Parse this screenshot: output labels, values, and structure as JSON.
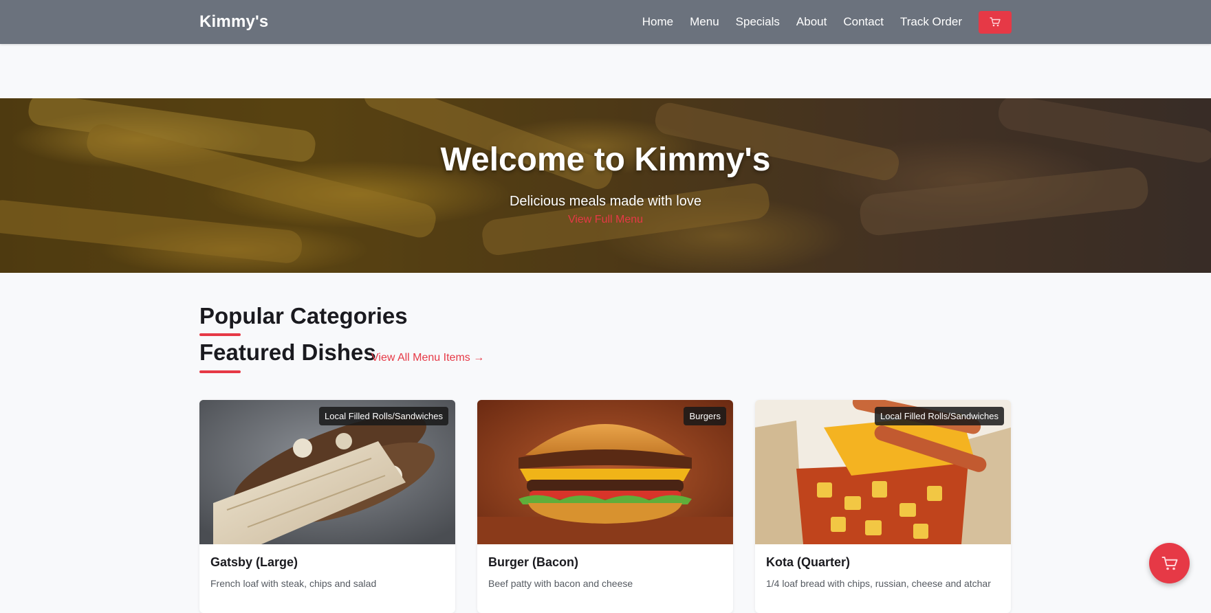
{
  "header": {
    "brand": "Kimmy's",
    "nav": [
      "Home",
      "Menu",
      "Specials",
      "About",
      "Contact",
      "Track Order"
    ],
    "cart_icon": "cart-icon"
  },
  "hero": {
    "title": "Welcome to Kimmy's",
    "subtitle": "Delicious meals made with love",
    "cta": "View Full Menu"
  },
  "sections": {
    "categories_title": "Popular Categories",
    "featured_title": "Featured Dishes",
    "view_all": "View All Menu Items →"
  },
  "dishes": [
    {
      "name": "Gatsby (Large)",
      "description": "French loaf with steak, chips and salad",
      "category": "Local Filled Rolls/Sandwiches"
    },
    {
      "name": "Burger (Bacon)",
      "description": "Beef patty with bacon and cheese",
      "category": "Burgers"
    },
    {
      "name": "Kota (Quarter)",
      "description": "1/4 loaf bread with chips, russian, cheese and atchar",
      "category": "Local Filled Rolls/Sandwiches"
    }
  ],
  "colors": {
    "nav_bg": "#6b727d",
    "accent": "#e63946",
    "page_bg": "#f8f9fb"
  },
  "floating_cart_icon": "cart-icon"
}
